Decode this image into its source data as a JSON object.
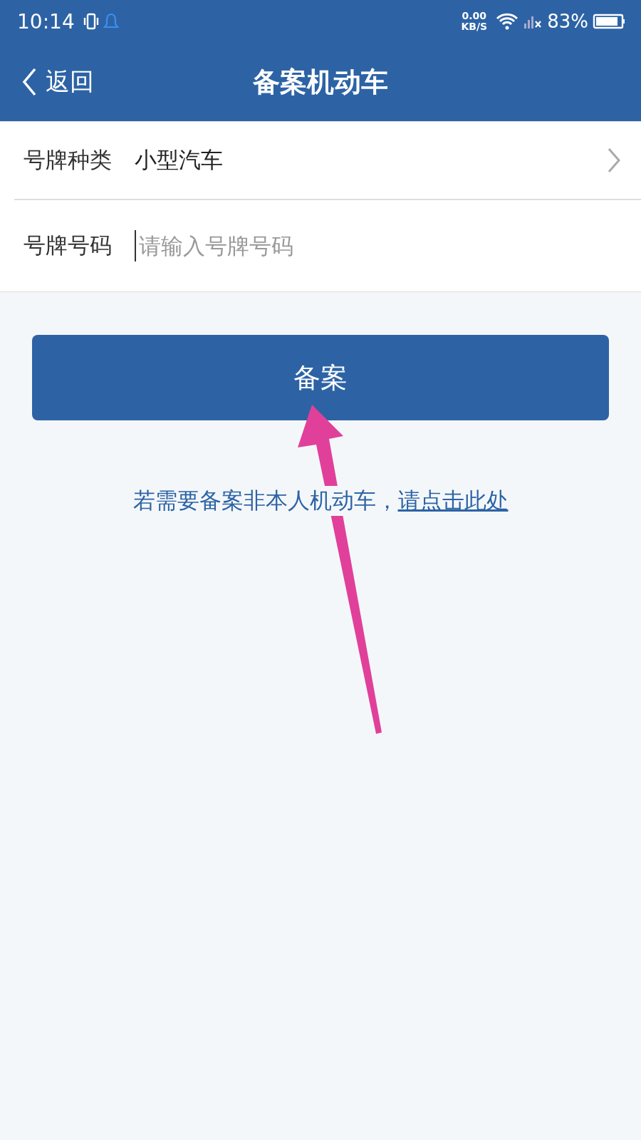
{
  "status_bar": {
    "time": "10:14",
    "speed_value": "0.00",
    "speed_unit": "KB/S",
    "battery": "83%"
  },
  "nav": {
    "back": "返回",
    "title": "备案机动车"
  },
  "form": [
    {
      "kind": "select",
      "label": "号牌种类",
      "value": "小型汽车"
    },
    {
      "kind": "input",
      "label": "号牌号码",
      "placeholder": "请输入号牌号码"
    }
  ],
  "submit": "备案",
  "note": {
    "text": "若需要备案非本人机动车，",
    "link": "请点击此处"
  }
}
